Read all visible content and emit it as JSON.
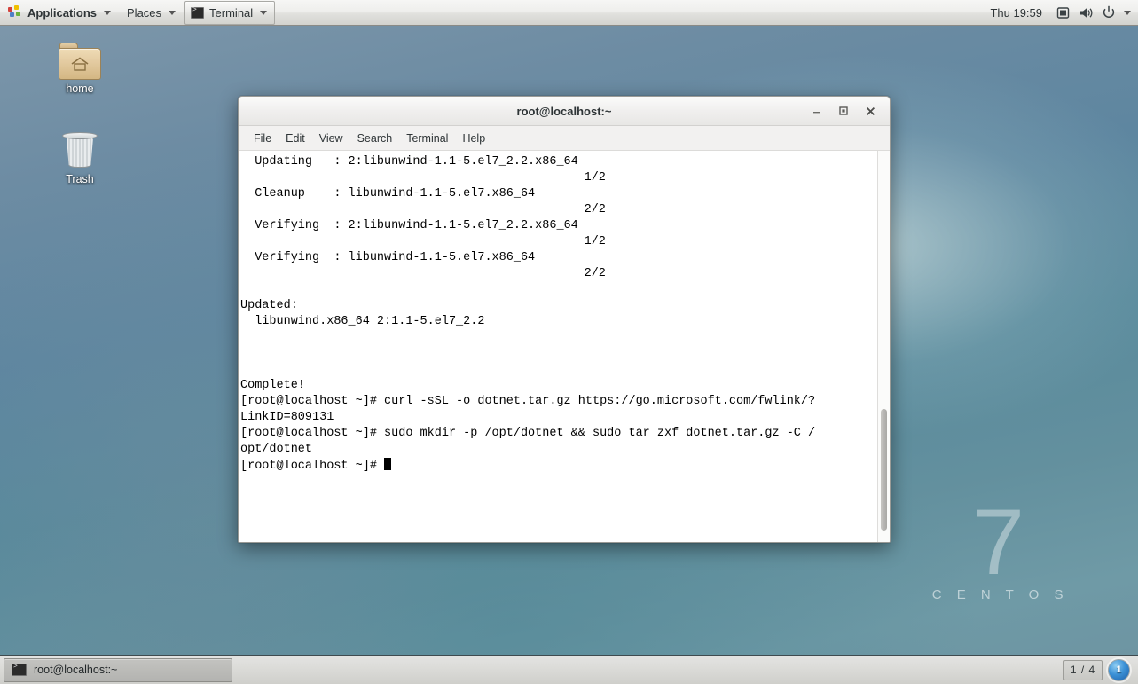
{
  "top_panel": {
    "applications_label": "Applications",
    "places_label": "Places",
    "apps_icon": "applications-icon",
    "window_list": [
      {
        "label": "Terminal",
        "icon": "terminal-icon"
      }
    ],
    "clock": "Thu 19:59",
    "tray": [
      {
        "name": "display-icon",
        "glyph": "▣"
      },
      {
        "name": "volume-icon",
        "glyph": "🔊"
      },
      {
        "name": "power-icon",
        "glyph": "⏻"
      }
    ]
  },
  "desktop": {
    "icons": [
      {
        "name": "home",
        "label": "home",
        "type": "folder"
      },
      {
        "name": "trash",
        "label": "Trash",
        "type": "trash"
      }
    ],
    "watermark": {
      "version": "7",
      "distro": "C E N T O S"
    },
    "wallpaper_color": "#5e86a0"
  },
  "terminal": {
    "title": "root@localhost:~",
    "window_buttons": [
      {
        "name": "minimize-button",
        "glyph": "–"
      },
      {
        "name": "maximize-button",
        "glyph": "□"
      },
      {
        "name": "close-button",
        "glyph": "✕"
      }
    ],
    "menus": [
      "File",
      "Edit",
      "View",
      "Search",
      "Terminal",
      "Help"
    ],
    "lines": [
      {
        "left": "  Updating   : 2:libunwind-1.1-5.el7_2.2.x86_64",
        "right": ""
      },
      {
        "left": "",
        "right": "1/2 "
      },
      {
        "left": "  Cleanup    : libunwind-1.1-5.el7.x86_64",
        "right": ""
      },
      {
        "left": "",
        "right": "2/2 "
      },
      {
        "left": "  Verifying  : 2:libunwind-1.1-5.el7_2.2.x86_64",
        "right": ""
      },
      {
        "left": "",
        "right": "1/2 "
      },
      {
        "left": "  Verifying  : libunwind-1.1-5.el7.x86_64",
        "right": ""
      },
      {
        "left": "",
        "right": "2/2 "
      },
      {
        "left": "",
        "right": ""
      },
      {
        "left": "Updated:",
        "right": ""
      },
      {
        "left": "  libunwind.x86_64 2:1.1-5.el7_2.2",
        "right": ""
      },
      {
        "left": "",
        "right": ""
      },
      {
        "left": "",
        "right": ""
      },
      {
        "left": "",
        "right": ""
      },
      {
        "left": "Complete!",
        "right": ""
      },
      {
        "left": "[root@localhost ~]# curl -sSL -o dotnet.tar.gz https://go.microsoft.com/fwlink/?",
        "right": ""
      },
      {
        "left": "LinkID=809131",
        "right": ""
      },
      {
        "left": "[root@localhost ~]# sudo mkdir -p /opt/dotnet && sudo tar zxf dotnet.tar.gz -C /",
        "right": ""
      },
      {
        "left": "opt/dotnet",
        "right": ""
      }
    ],
    "prompt": "[root@localhost ~]# ",
    "cursor": "block",
    "scroll_position_percent": 66
  },
  "bottom_panel": {
    "tasks": [
      {
        "label": "root@localhost:~",
        "icon": "terminal-icon",
        "active": true
      }
    ],
    "workspace_indicator": "1 / 4",
    "show_desktop_label": "1"
  }
}
